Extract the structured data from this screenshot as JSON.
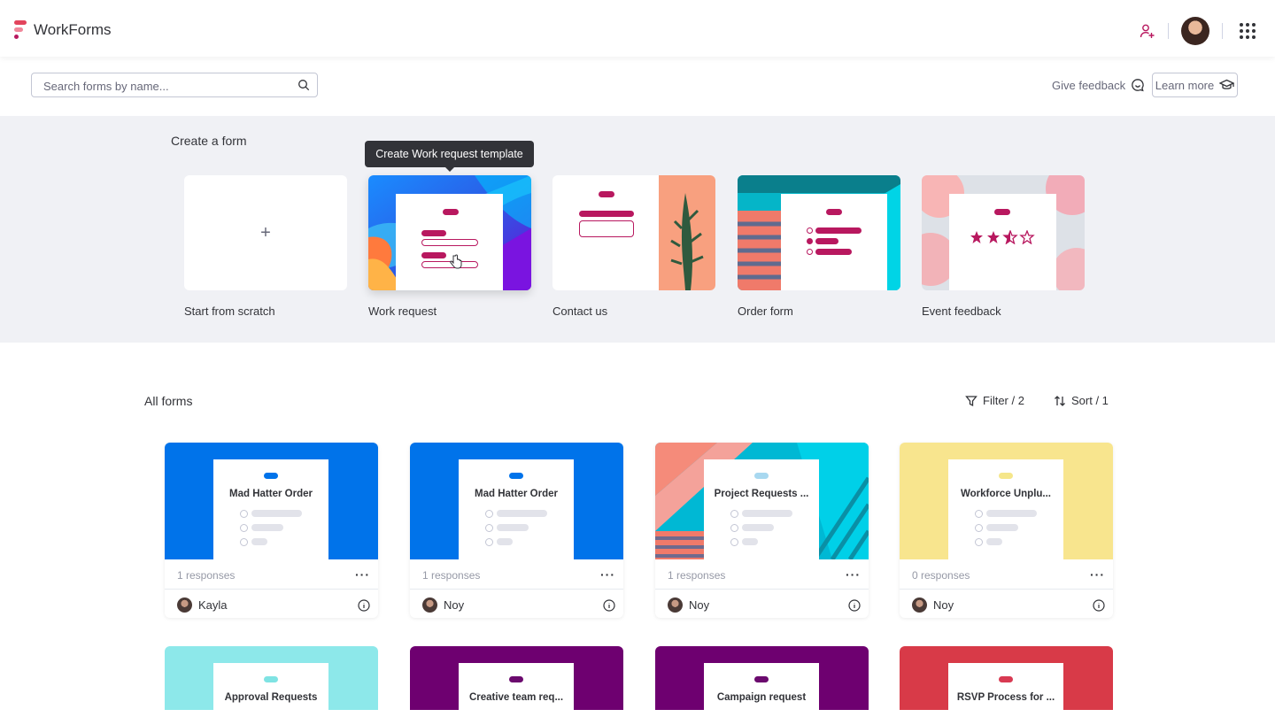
{
  "header": {
    "brand": "WorkForms",
    "logo_icon": "workforms-logo-icon",
    "invite_icon": "add-person-icon",
    "apps_icon": "apps-grid-icon"
  },
  "toolbar": {
    "search_placeholder": "Search forms by name...",
    "search_value": "",
    "give_feedback": "Give feedback",
    "learn_more": "Learn more"
  },
  "create": {
    "title": "Create a form",
    "tooltip": "Create Work request template",
    "templates": [
      {
        "label": "Start from scratch"
      },
      {
        "label": "Work request"
      },
      {
        "label": "Contact us"
      },
      {
        "label": "Order form"
      },
      {
        "label": "Event feedback"
      }
    ],
    "plus_symbol": "+"
  },
  "forms": {
    "title": "All forms",
    "filter": "Filter / 2",
    "sort": "Sort / 1",
    "cards": [
      {
        "title": "Mad Hatter Order",
        "responses": "1 responses",
        "owner": "Kayla",
        "dash_color": "#0073ea"
      },
      {
        "title": "Mad Hatter Order",
        "responses": "1 responses",
        "owner": "Noy",
        "dash_color": "#0073ea"
      },
      {
        "title": "Project Requests ...",
        "responses": "1 responses",
        "owner": "Noy",
        "dash_color": "#a8d8f0"
      },
      {
        "title": "Workforce Unplu...",
        "responses": "0 responses",
        "owner": "Noy",
        "dash_color": "#f5e68a"
      }
    ],
    "cards_row2": [
      {
        "title": "Approval Requests",
        "dash_color": "#7fe3e3"
      },
      {
        "title": "Creative team req...",
        "dash_color": "#6b0a6e"
      },
      {
        "title": "Campaign request",
        "dash_color": "#6b0a6e"
      },
      {
        "title": "RSVP Process for ...",
        "dash_color": "#d83a52"
      }
    ],
    "more_symbol": "···"
  },
  "colors": {
    "accent": "#b8185f",
    "blue": "#0073ea",
    "yellow": "#f8e58e",
    "teal": "#8de8ea",
    "purple": "#6e0070",
    "red": "#d83a48"
  }
}
